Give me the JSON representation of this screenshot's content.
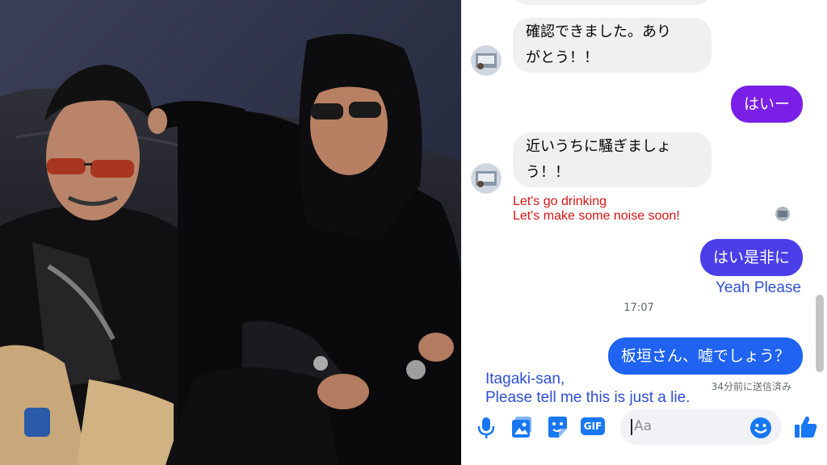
{
  "colors": {
    "purple": "#7a1fe6",
    "blue": "#1f63f0",
    "translation_red": "#d81414",
    "translation_blue": "#2d4fd6",
    "icon_blue": "#1877f2"
  },
  "messages": {
    "m1": {
      "line1": "確認できました。あり",
      "line2": "がとう！！"
    },
    "m2": "はいー",
    "m3": {
      "line1": "近いうちに騒ぎましょ",
      "line2": "う！！"
    },
    "m3_translation": {
      "line1": "Let's go drinking",
      "line2": "Let's make some noise soon!"
    },
    "m4": "はい是非に",
    "m4_translation": "Yeah Please",
    "timestamp": "17:07",
    "m5": "板垣さん、嘘でしょう？",
    "m5_status": "34分前に送信済み",
    "m5_translation": {
      "line1": "Itagaki-san,",
      "line2": "Please tell me this is just a lie."
    }
  },
  "composer": {
    "placeholder": "Aa",
    "gif_label": "GIF"
  },
  "icons": [
    "microphone-icon",
    "image-icon",
    "sticker-icon",
    "gif-icon",
    "emoji-icon",
    "thumbs-up-icon"
  ]
}
